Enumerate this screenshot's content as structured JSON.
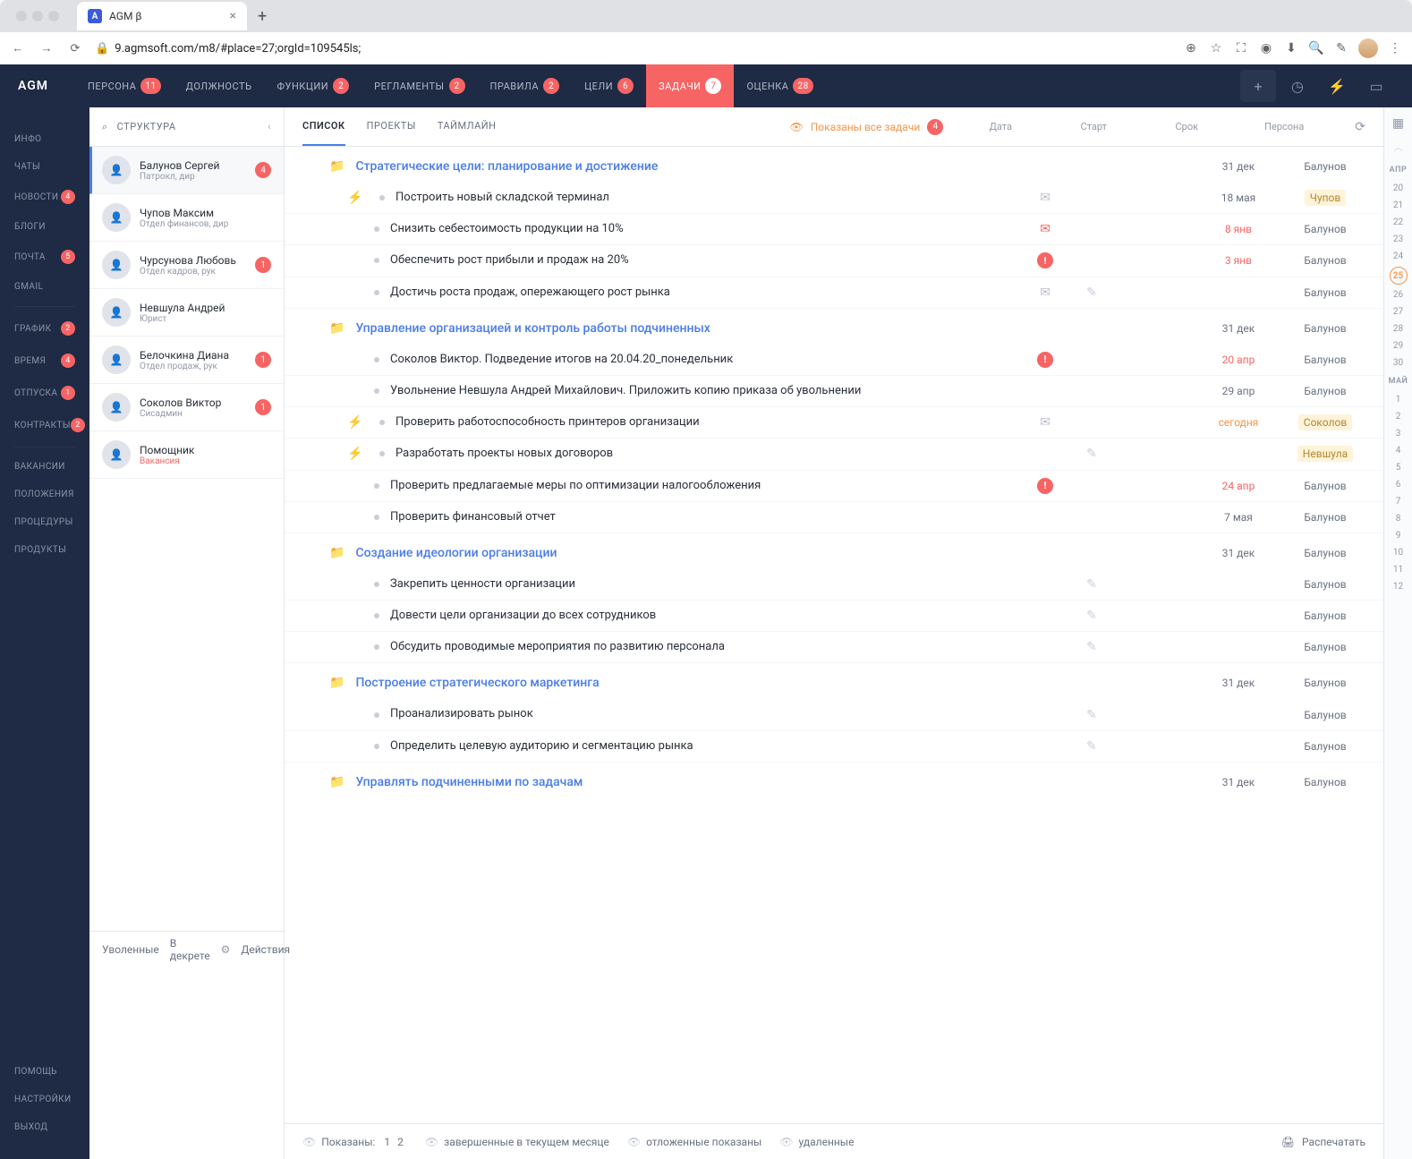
{
  "browser": {
    "tab_title": "AGM β",
    "url": "9.agmsoft.com/m8/#place=27;orgId=109545ls;"
  },
  "topnav": {
    "logo": "AGM",
    "items": [
      {
        "label": "ПЕРСОНА",
        "badge": "11"
      },
      {
        "label": "ДОЛЖНОСТЬ",
        "badge": ""
      },
      {
        "label": "ФУНКЦИИ",
        "badge": "2"
      },
      {
        "label": "РЕГЛАМЕНТЫ",
        "badge": "2"
      },
      {
        "label": "ПРАВИЛА",
        "badge": "2"
      },
      {
        "label": "ЦЕЛИ",
        "badge": "6"
      },
      {
        "label": "ЗАДАЧИ",
        "badge": "7",
        "active": true
      },
      {
        "label": "ОЦЕНКА",
        "badge": "28"
      }
    ]
  },
  "leftnav": {
    "top": [
      {
        "label": "ИНФО",
        "badge": ""
      },
      {
        "label": "ЧАТЫ",
        "badge": ""
      },
      {
        "label": "НОВОСТИ",
        "badge": "4"
      },
      {
        "label": "БЛОГИ",
        "badge": ""
      },
      {
        "label": "ПОЧТА",
        "badge": "5"
      },
      {
        "label": "GMAIL",
        "badge": ""
      }
    ],
    "mid": [
      {
        "label": "ГРАФИК",
        "badge": "2"
      },
      {
        "label": "ВРЕМЯ",
        "badge": "4"
      },
      {
        "label": "ОТПУСКА",
        "badge": "1"
      },
      {
        "label": "КОНТРАКТЫ",
        "badge": "2"
      }
    ],
    "mid2": [
      {
        "label": "ВАКАНСИИ",
        "badge": ""
      },
      {
        "label": "ПОЛОЖЕНИЯ",
        "badge": ""
      },
      {
        "label": "ПРОЦЕДУРЫ",
        "badge": ""
      },
      {
        "label": "ПРОДУКТЫ",
        "badge": ""
      }
    ],
    "bottom": [
      {
        "label": "ПОМОЩЬ"
      },
      {
        "label": "НАСТРОЙКИ"
      },
      {
        "label": "ВЫХОД"
      }
    ]
  },
  "struct": {
    "header": "СТРУКТУРА",
    "people": [
      {
        "name": "Балунов Сергей",
        "role": "Патрокл, дир",
        "badge": "4",
        "sel": true
      },
      {
        "name": "Чупов Максим",
        "role": "Отдел финансов, дир",
        "badge": ""
      },
      {
        "name": "Чурсунова Любовь",
        "role": "Отдел кадров, рук",
        "badge": "1"
      },
      {
        "name": "Невшула Андрей",
        "role": "Юрист",
        "badge": ""
      },
      {
        "name": "Белочкина Диана",
        "role": "Отдел продаж, рук",
        "badge": "1"
      },
      {
        "name": "Соколов Виктор",
        "role": "Сисадмин",
        "badge": "1"
      },
      {
        "name": "Помощник",
        "role": "Вакансия",
        "badge": "",
        "vac": true
      }
    ]
  },
  "viewtabs": {
    "items": [
      "СПИСОК",
      "ПРОЕКТЫ",
      "ТАЙМЛАЙН"
    ],
    "filter_text": "Показаны все задачи",
    "filter_badge": "4",
    "cols": {
      "date": "Дата",
      "start": "Старт",
      "due": "Срок",
      "person": "Персона"
    }
  },
  "groups": [
    {
      "title": "Стратегические цели: планирование и достижение",
      "date": "31 дек",
      "person": "Балунов",
      "tasks": [
        {
          "bolt": true,
          "name": "Построить новый складской терминал",
          "icon": "mail",
          "due": "18 мая",
          "person": "Чупов",
          "hl": true
        },
        {
          "name": "Снизить себестоимость продукции на 10%",
          "icon": "mail-red",
          "due": "8 янв",
          "due_red": true,
          "person": "Балунов"
        },
        {
          "name": "Обеспечить рост прибыли и продаж на 20%",
          "icon": "warn",
          "due": "3 янв",
          "due_red": true,
          "person": "Балунов"
        },
        {
          "name": "Достичь роста продаж, опережающего рост рынка",
          "icon": "mail",
          "pencil": true,
          "person": "Балунов"
        }
      ]
    },
    {
      "title": "Управление организацией и контроль работы подчиненных",
      "date": "31 дек",
      "person": "Балунов",
      "yellow_folder": true,
      "tasks": [
        {
          "name": "Соколов Виктор. Подведение итогов на 20.04.20_понедельник",
          "icon": "warn",
          "due": "20 апр",
          "due_red": true,
          "person": "Балунов"
        },
        {
          "name": "Увольнение Невшула Андрей Михайлович. Приложить копию приказа об увольнении",
          "due": "29 апр",
          "person": "Балунов"
        },
        {
          "bolt": true,
          "name": "Проверить работоспособность принтеров организации",
          "icon": "mail",
          "due": "сегодня",
          "due_today": true,
          "person": "Соколов",
          "hl": true
        },
        {
          "bolt": true,
          "name": "Разработать проекты новых договоров",
          "pencil": true,
          "person": "Невшула",
          "hl": true
        },
        {
          "name": "Проверить предлагаемые меры по оптимизации налогообложения",
          "icon": "warn",
          "due": "24 апр",
          "due_red": true,
          "person": "Балунов"
        },
        {
          "name": "Проверить финансовый отчет",
          "due": "7 мая",
          "person": "Балунов"
        }
      ]
    },
    {
      "title": "Создание идеологии организации",
      "date": "31 дек",
      "person": "Балунов",
      "tasks": [
        {
          "name": "Закрепить ценности организации",
          "pencil": true,
          "person": "Балунов"
        },
        {
          "name": "Довести цели организации до всех сотрудников",
          "pencil": true,
          "person": "Балунов"
        },
        {
          "name": "Обсудить проводимые мероприятия по развитию персонала",
          "pencil": true,
          "person": "Балунов"
        }
      ]
    },
    {
      "title": "Построение стратегического маркетинга",
      "date": "31 дек",
      "person": "Балунов",
      "tasks": [
        {
          "name": "Проанализировать рынок",
          "pencil": true,
          "person": "Балунов"
        },
        {
          "name": "Определить целевую аудиторию и сегментацию рынка",
          "pencil": true,
          "person": "Балунов"
        }
      ]
    },
    {
      "title": "Управлять подчиненными по задачам",
      "date": "31 дек",
      "person": "Балунов",
      "tasks": []
    }
  ],
  "footer": {
    "fired": "Уволенные",
    "decree": "В декрете",
    "actions": "Действия",
    "shown": "Показаны:",
    "pages": [
      "1",
      "2"
    ],
    "f1": "завершенные в текущем месяце",
    "f2": "отложенные показаны",
    "f3": "удаленные",
    "print": "Распечатать"
  },
  "calendar": {
    "month1": "АПР",
    "days1": [
      "20",
      "21",
      "22",
      "23",
      "24",
      "25",
      "26",
      "27",
      "28",
      "29",
      "30"
    ],
    "today": "25",
    "month2": "МАЙ",
    "days2": [
      "1",
      "2",
      "3",
      "4",
      "5",
      "6",
      "7",
      "8",
      "9",
      "10",
      "11",
      "12"
    ]
  }
}
